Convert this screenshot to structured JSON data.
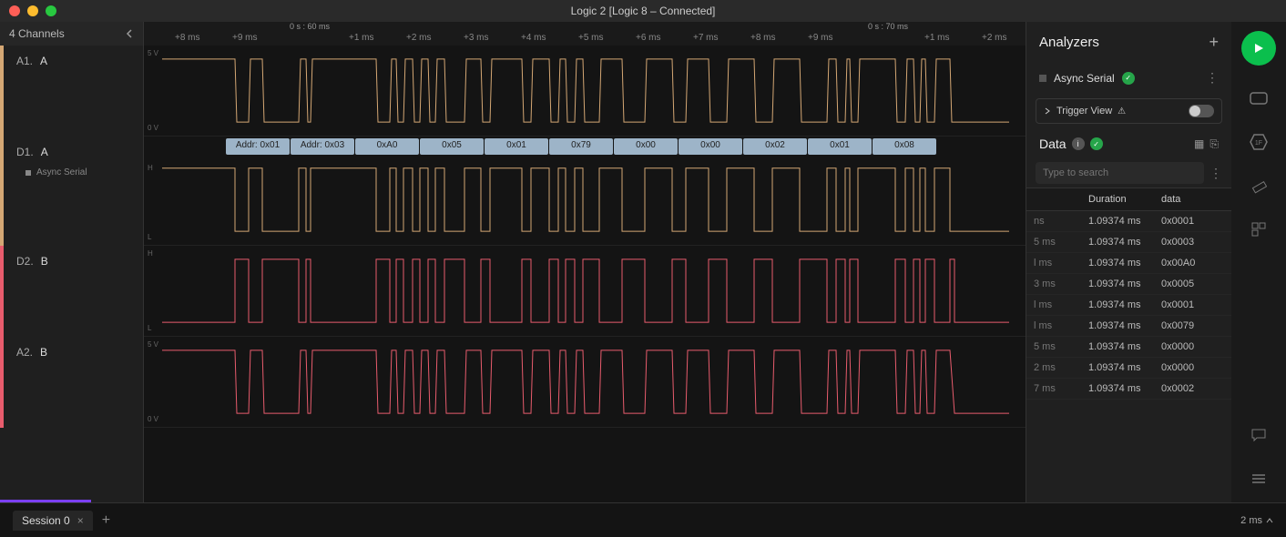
{
  "window": {
    "title": "Logic 2 [Logic 8 – Connected]"
  },
  "sidebar": {
    "header": "4 Channels",
    "channels": [
      {
        "id": "A1.",
        "name": "A",
        "sub": ""
      },
      {
        "id": "D1.",
        "name": "A",
        "sub": "Async Serial"
      },
      {
        "id": "D2.",
        "name": "B",
        "sub": ""
      },
      {
        "id": "A2.",
        "name": "B",
        "sub": ""
      }
    ]
  },
  "ruler": {
    "major1": "0 s : 60 ms",
    "major2": "0 s : 70 ms",
    "ticks": [
      "+8 ms",
      "+9 ms",
      "+1 ms",
      "+2 ms",
      "+3 ms",
      "+4 ms",
      "+5 ms",
      "+6 ms",
      "+7 ms",
      "+8 ms",
      "+9 ms",
      "+1 ms",
      "+2 ms"
    ]
  },
  "voltage": {
    "hi_a": "5 V",
    "lo_a": "0 V",
    "hi_d": "H",
    "lo_d": "L"
  },
  "decode": [
    "Addr: 0x01",
    "Addr: 0x03",
    "0xA0",
    "0x05",
    "0x01",
    "0x79",
    "0x00",
    "0x00",
    "0x02",
    "0x01",
    "0x08"
  ],
  "analyzers": {
    "title": "Analyzers",
    "item": "Async Serial",
    "trigger": "Trigger View"
  },
  "data_panel": {
    "title": "Data",
    "search_placeholder": "Type to search",
    "columns": {
      "c1": "",
      "c2": "Duration",
      "c3": "data"
    },
    "rows": [
      {
        "t": "ns",
        "dur": "1.09374 ms",
        "d": "0x0001"
      },
      {
        "t": "5 ms",
        "dur": "1.09374 ms",
        "d": "0x0003"
      },
      {
        "t": "l ms",
        "dur": "1.09374 ms",
        "d": "0x00A0"
      },
      {
        "t": "3 ms",
        "dur": "1.09374 ms",
        "d": "0x0005"
      },
      {
        "t": "l ms",
        "dur": "1.09374 ms",
        "d": "0x0001"
      },
      {
        "t": "l ms",
        "dur": "1.09374 ms",
        "d": "0x0079"
      },
      {
        "t": "5 ms",
        "dur": "1.09374 ms",
        "d": "0x0000"
      },
      {
        "t": "2 ms",
        "dur": "1.09374 ms",
        "d": "0x0000"
      },
      {
        "t": "7 ms",
        "dur": "1.09374 ms",
        "d": "0x0002"
      }
    ]
  },
  "tabbar": {
    "session": "Session 0",
    "zoom": "2 ms"
  },
  "chart_data": {
    "type": "digital-waveform",
    "time_window_ms": [
      58,
      72
    ],
    "channels": {
      "A1": {
        "kind": "analog",
        "range_v": [
          0,
          5
        ]
      },
      "D1": {
        "kind": "digital",
        "analyzer": "Async Serial",
        "bytes": [
          "0x01",
          "0x03",
          "0xA0",
          "0x05",
          "0x01",
          "0x79",
          "0x00",
          "0x00",
          "0x02",
          "0x01",
          "0x08"
        ]
      },
      "D2": {
        "kind": "digital"
      },
      "A2": {
        "kind": "analog",
        "range_v": [
          0,
          5
        ]
      }
    }
  }
}
